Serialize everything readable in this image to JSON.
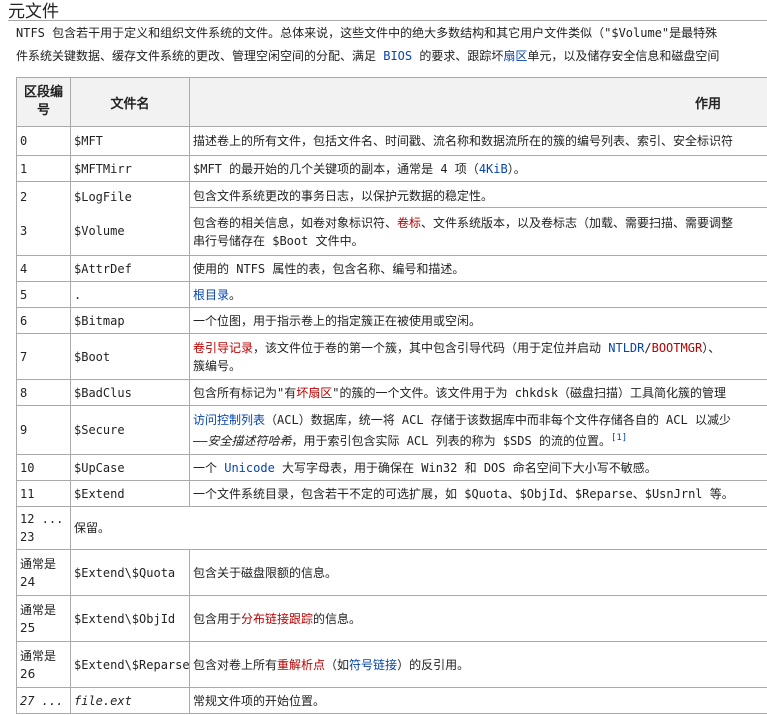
{
  "heading": "元文件",
  "intro_line1": "NTFS 包含若干用于定义和组织文件系统的文件。总体来说，这些文件中的绝大多数结构和其它用户文件类似（\"$Volume\"是最特殊",
  "intro_line2_a": "件系统关键数据、缓存文件系统的更改、管理空闲空间的分配、满足 ",
  "intro_line2_bios": "BIOS",
  "intro_line2_b": " 的要求、跟踪坏",
  "intro_line2_sector": "扇区",
  "intro_line2_c": "单元，以及储存安全信息和磁盘空间",
  "table": {
    "headers": [
      "区段编号",
      "文件名",
      "作用"
    ],
    "rows": [
      {
        "seg": "0",
        "name": "$MFT",
        "desc": "描述卷上的所有文件，包括文件名、时间戳、流名称和数据流所在的簇的编号列表、索引、安全标识符"
      },
      {
        "seg": "1",
        "name": "$MFTMirr",
        "desc_a": "$MFT 的最开始的几个关键项的副本，通常是 4 项（",
        "desc_link": "4KiB",
        "desc_b": "）。"
      },
      {
        "seg": "2",
        "name": "$LogFile",
        "desc": "包含文件系统更改的事务日志，以保护元数据的稳定性。"
      },
      {
        "seg": "3",
        "name": "$Volume",
        "desc_a": "包含卷的相关信息，如卷对象标识符、",
        "desc_link": "卷标",
        "desc_b": "、文件系统版本，以及卷标志（加载、需要扫描、需要调整",
        "desc_c": "串行号储存在 $Boot 文件中。"
      },
      {
        "seg": "4",
        "name": "$AttrDef",
        "desc": "使用的 NTFS 属性的表，包含名称、编号和描述。"
      },
      {
        "seg": "5",
        "name": ".",
        "desc_link": "根目录",
        "desc_b": "。"
      },
      {
        "seg": "6",
        "name": "$Bitmap",
        "desc": "一个位图，用于指示卷上的指定簇正在被使用或空闲。"
      },
      {
        "seg": "7",
        "name": "$Boot",
        "desc_link": "卷引导记录",
        "desc_b": "，该文件位于卷的第一个簇，其中包含引导代码（用于定位并启动 ",
        "desc_link2": "NTLDR",
        "desc_sep": "/",
        "desc_link3": "BOOTMGR",
        "desc_c": "）、",
        "desc_d": "簇编号。"
      },
      {
        "seg": "8",
        "name": "$BadClus",
        "desc_a": "包含所有标记为\"有",
        "desc_link": "坏扇区",
        "desc_b": "\"的簇的一个文件。该文件用于为 chkdsk（磁盘扫描）工具简化簇的管理"
      },
      {
        "seg": "9",
        "name": "$Secure",
        "desc_link": "访问控制列表",
        "desc_b": "（ACL）数据库，统一将 ACL 存储于该数据库中而非每个文件存储各自的 ACL 以减少",
        "desc_c1": "——",
        "desc_ital": "安全描述符哈希",
        "desc_c2": "，用于索引包含实际 ACL 列表的称为 $SDS 的流的位置。",
        "desc_ref": "[1]"
      },
      {
        "seg": "10",
        "name": "$UpCase",
        "desc_a": "一个 ",
        "desc_link": "Unicode",
        "desc_b": " 大写字母表，用于确保在 Win32 和 DOS 命名空间下大小写不敏感。"
      },
      {
        "seg": "11",
        "name": "$Extend",
        "desc": "一个文件系统目录，包含若干不定的可选扩展，如 $Quota、$ObjId、$Reparse、$UsnJrnl 等。"
      },
      {
        "seg": "12 ... 23",
        "name": "保留。",
        "desc": ""
      },
      {
        "seg": "通常是 24",
        "name": "$Extend\\$Quota",
        "desc": "包含关于磁盘限额的信息。"
      },
      {
        "seg": "通常是 25",
        "name": "$Extend\\$ObjId",
        "desc_a": "包含用于",
        "desc_link": "分布链接跟踪",
        "desc_b": "的信息。"
      },
      {
        "seg": "通常是 26",
        "name": "$Extend\\$Reparse",
        "desc_a": "包含对卷上所有",
        "desc_link": "重解析点",
        "desc_b": "（如",
        "desc_link2": "符号链接",
        "desc_c": "）的反引用。"
      },
      {
        "seg": "27 ...",
        "name": "file.ext",
        "desc": "常规文件项的开始位置。"
      }
    ]
  },
  "colors": {
    "link": "#0645ad",
    "redlink": "#ba0000",
    "header_bg": "#f2f2f2",
    "border": "#aaaaaa"
  }
}
